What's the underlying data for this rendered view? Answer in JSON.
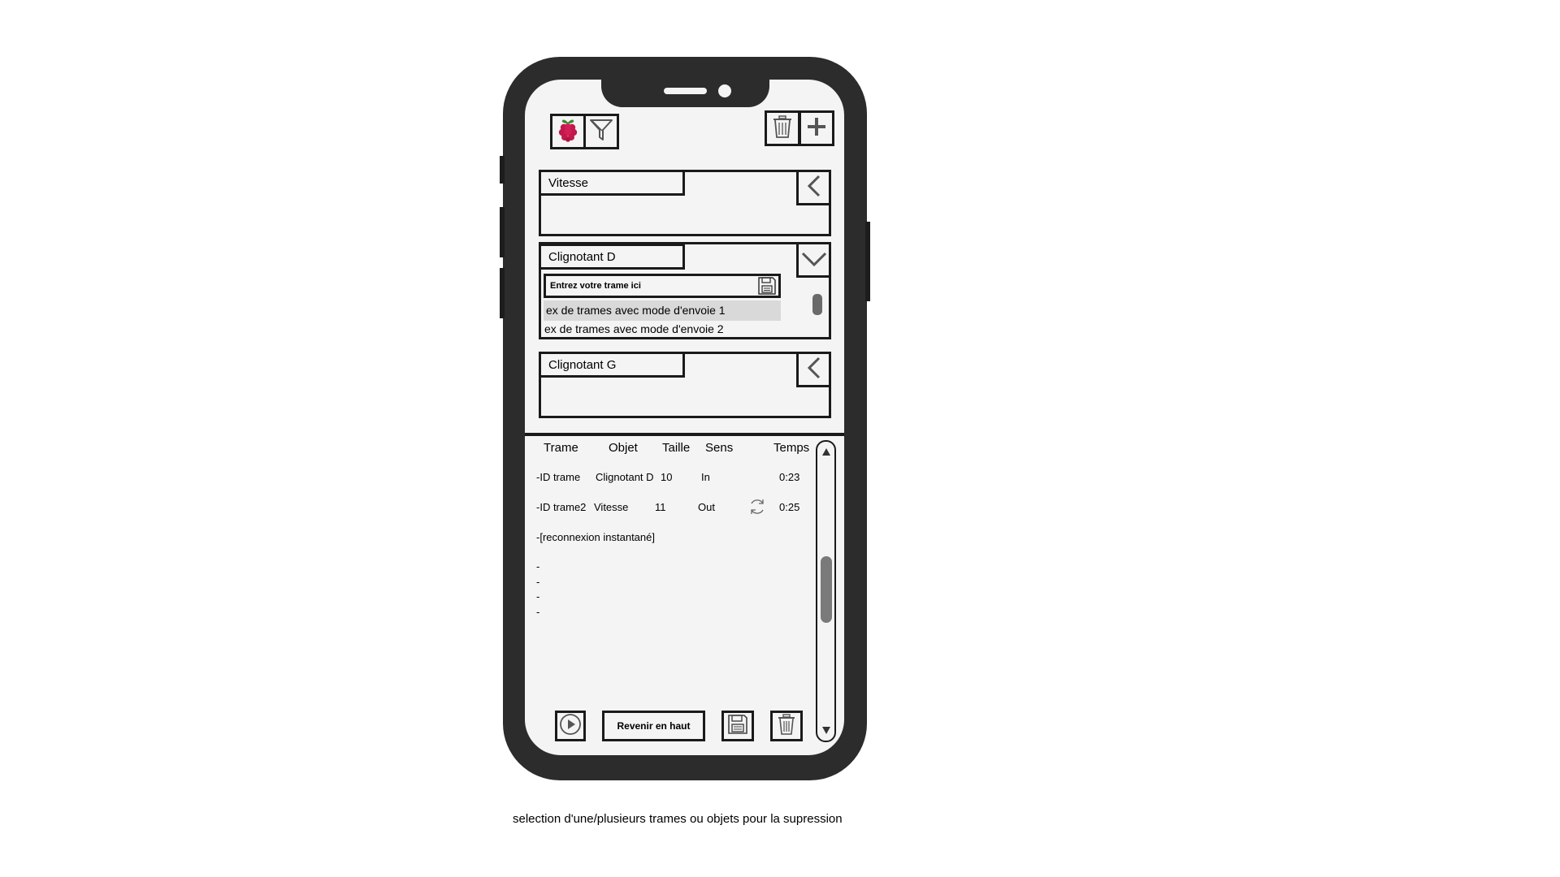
{
  "toolbar": {
    "raspberry_icon": "raspberry-icon",
    "filter_icon": "filter-icon",
    "trash_icon": "trash-icon",
    "add_icon": "plus-icon"
  },
  "objects": [
    {
      "name": "Vitesse",
      "state": "collapsed"
    },
    {
      "name": "Clignotant D",
      "state": "expanded",
      "input_placeholder": "Entrez votre trame ici",
      "frames": [
        "ex de trames avec mode d'envoie 1",
        "ex de trames avec mode d'envoie 2"
      ]
    },
    {
      "name": "Clignotant G",
      "state": "collapsed"
    }
  ],
  "log": {
    "columns": [
      "Trame",
      "Objet",
      "Taille",
      "Sens",
      "Temps"
    ],
    "rows": [
      {
        "trame": "-ID trame",
        "objet": "Clignotant D",
        "taille": "10",
        "sens": "In",
        "temps": "0:23"
      },
      {
        "trame": "-ID trame2",
        "objet": "Vitesse",
        "taille": "11",
        "sens": "Out",
        "temps": "0:25"
      }
    ],
    "event": "-[reconnexion instantané]",
    "dashes": [
      "-",
      "-",
      "-",
      "-"
    ]
  },
  "bottom_bar": {
    "back_to_top": "Revenir en haut"
  },
  "caption": "selection d'une/plusieurs trames ou objets pour la supression",
  "colors": {
    "frame": "#2c2c2c",
    "screen": "#f4f4f4",
    "highlight": "#d9d9d9"
  }
}
